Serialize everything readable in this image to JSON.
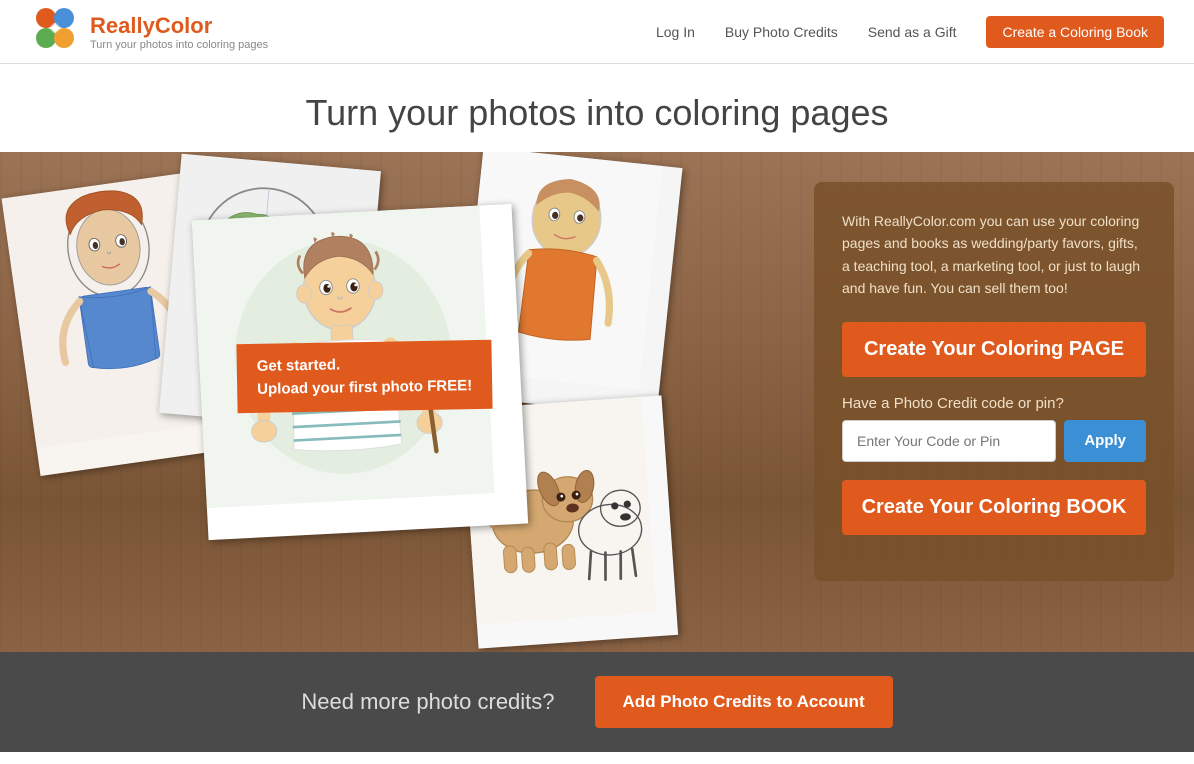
{
  "header": {
    "logo_name": "ReallyColor",
    "logo_tm": "™",
    "logo_tagline": "Turn your photos into coloring pages",
    "nav": {
      "login": "Log In",
      "buy_credits": "Buy Photo Credits",
      "send_gift": "Send as a Gift",
      "create_book": "Create a Coloring Book"
    }
  },
  "hero": {
    "title": "Turn your photos into coloring pages",
    "description": "With ReallyColor.com you can use your coloring pages and books as wedding/party favors, gifts, a teaching tool, a marketing tool, or just to laugh and have fun. You can sell them too!",
    "btn_page": "Create Your Coloring PAGE",
    "credit_label": "Have a Photo Credit code or pin?",
    "credit_placeholder": "Enter Your Code or Pin",
    "btn_apply": "Apply",
    "btn_book": "Create Your Coloring BOOK",
    "get_started_line1": "Get started.",
    "get_started_line2": "Upload your first photo FREE!"
  },
  "footer": {
    "text": "Need more photo credits?",
    "btn_add": "Add Photo Credits to Account"
  }
}
